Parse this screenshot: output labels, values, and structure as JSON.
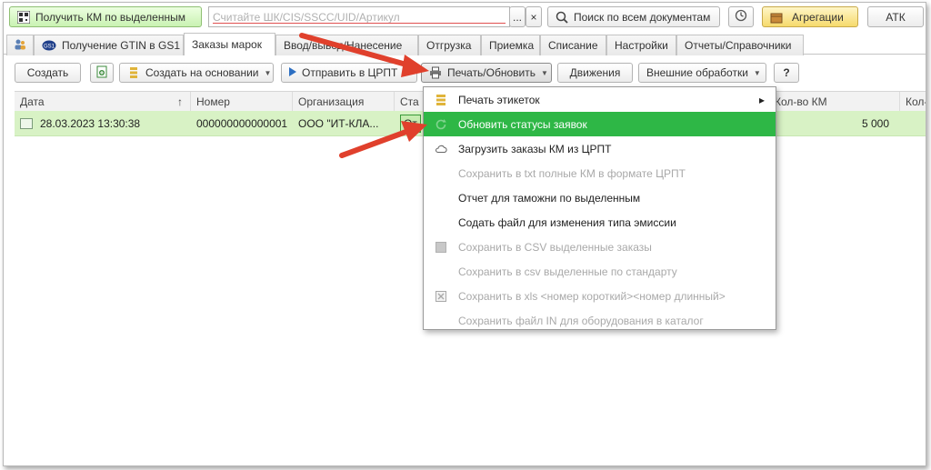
{
  "toolbar_top": {
    "get_km_label": "Получить КМ по выделенным",
    "scan_placeholder": "Считайте ШК/CIS/SSCC/UID/Артикул",
    "scan_more": "...",
    "scan_clear": "×",
    "search_all_label": "Поиск по всем документам",
    "aggregation_label": "Агрегации",
    "atk_label": "АТК"
  },
  "tabs": [
    {
      "label": "Получение GTIN в GS1"
    },
    {
      "label": "Заказы марок"
    },
    {
      "label": "Ввод/вывод/Нанесение"
    },
    {
      "label": "Отгрузка"
    },
    {
      "label": "Приемка"
    },
    {
      "label": "Списание"
    },
    {
      "label": "Настройки"
    },
    {
      "label": "Отчеты/Справочники"
    }
  ],
  "actions": {
    "create": "Создать",
    "create_based": "Создать на основании",
    "send_crpt": "Отправить в ЦРПТ",
    "print_refresh": "Печать/Обновить",
    "movements": "Движения",
    "external": "Внешние обработки",
    "help": "?"
  },
  "table": {
    "columns": [
      "Дата",
      "Номер",
      "Организация",
      "Ста",
      "Кол-во КМ",
      "Кол-в"
    ],
    "sort_indicator": "↑",
    "rows": [
      {
        "date": "28.03.2023 13:30:38",
        "number": "000000000000001",
        "org": "ООО \"ИТ-КЛА...",
        "status": "От",
        "km_count": "5 000"
      }
    ]
  },
  "menu": {
    "items": [
      {
        "label": "Печать этикеток",
        "enabled": true
      },
      {
        "label": "Обновить статусы заявок",
        "enabled": true,
        "selected": true
      },
      {
        "label": "Загрузить заказы КМ из ЦРПТ",
        "enabled": true
      },
      {
        "label": "Сохранить в txt полные КМ в формате ЦРПТ",
        "enabled": false
      },
      {
        "label": "Отчет для таможни по выделенным",
        "enabled": true
      },
      {
        "label": "Содать файл для изменения типа эмиссии",
        "enabled": true
      },
      {
        "label": "Сохранить в CSV выделенные заказы",
        "enabled": false
      },
      {
        "label": "Сохранить в csv выделенные по стандарту",
        "enabled": false
      },
      {
        "label": "Сохранить в xls <номер короткий><номер длинный>",
        "enabled": false
      },
      {
        "label": "Сохранить файл IN для оборудования в каталог",
        "enabled": false
      }
    ],
    "submenu_arrow": "▸"
  },
  "colors": {
    "selected_row": "#d8f2c5",
    "menu_highlight": "#2eb746",
    "annotation_arrow": "#e0402c"
  }
}
